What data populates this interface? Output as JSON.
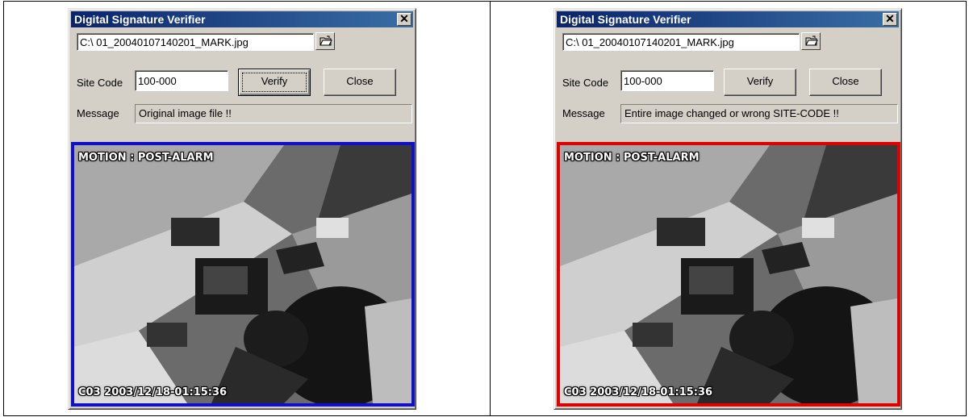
{
  "panels": [
    {
      "window_title": "Digital Signature Verifier",
      "close_glyph": "✕",
      "file_path": "C:\\ 01_20040107140201_MARK.jpg",
      "browse_icon": "open-folder-icon",
      "site_code_label": "Site Code",
      "site_code_value": "100-000",
      "verify_label": "Verify",
      "close_label": "Close",
      "message_label": "Message",
      "message_text": "Original image file !!",
      "frame_color": "#1010c8",
      "overlay_top": "MOTION : POST-ALARM",
      "overlay_bottom": "C03 2003/12/18-01:15:36"
    },
    {
      "window_title": "Digital Signature Verifier",
      "close_glyph": "✕",
      "file_path": "C:\\ 01_20040107140201_MARK.jpg",
      "browse_icon": "open-folder-icon",
      "site_code_label": "Site Code",
      "site_code_value": "100-000",
      "verify_label": "Verify",
      "close_label": "Close",
      "message_label": "Message",
      "message_text": "Entire image changed or wrong SITE-CODE !!",
      "frame_color": "#e00000",
      "overlay_top": "MOTION : POST-ALARM",
      "overlay_bottom": "C03 2003/12/18-01:15:36"
    }
  ]
}
